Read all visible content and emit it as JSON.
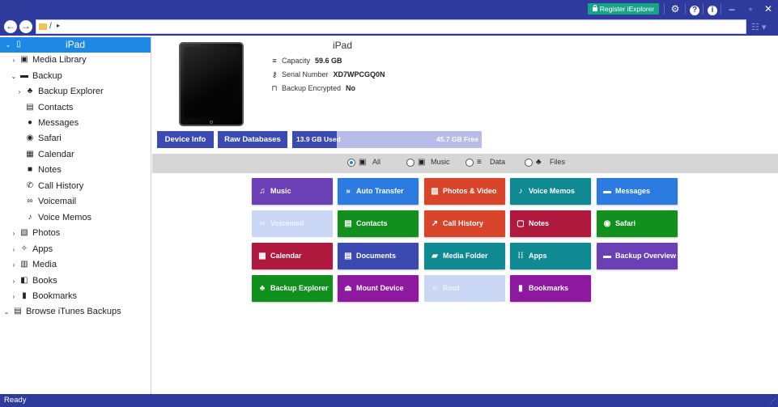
{
  "titlebar": {
    "register_label": "Register iExplorer",
    "icons": [
      "gear-icon",
      "help-icon",
      "info-icon",
      "minimize-icon",
      "maximize-icon",
      "close-icon"
    ]
  },
  "address": {
    "path": "/",
    "caret": "▸"
  },
  "sidebar": {
    "root": {
      "label": "iPad",
      "icon": "tablet-icon"
    },
    "items": [
      {
        "label": "Media Library",
        "icon": "media-library-icon",
        "expander": "›"
      },
      {
        "label": "Backup",
        "icon": "backup-icon",
        "expander": "⌄"
      },
      {
        "label": "Backup Explorer",
        "icon": "sitemap-icon",
        "expander": "›"
      },
      {
        "label": "Contacts",
        "icon": "contact-card-icon"
      },
      {
        "label": "Messages",
        "icon": "chat-icon"
      },
      {
        "label": "Safari",
        "icon": "compass-icon"
      },
      {
        "label": "Calendar",
        "icon": "calendar-icon"
      },
      {
        "label": "Notes",
        "icon": "note-icon"
      },
      {
        "label": "Call History",
        "icon": "phone-icon"
      },
      {
        "label": "Voicemail",
        "icon": "voicemail-icon"
      },
      {
        "label": "Voice Memos",
        "icon": "voice-memo-icon"
      },
      {
        "label": "Photos",
        "icon": "photo-icon",
        "expander": "›"
      },
      {
        "label": "Apps",
        "icon": "apps-icon",
        "expander": "›"
      },
      {
        "label": "Media",
        "icon": "film-icon",
        "expander": "›"
      },
      {
        "label": "Books",
        "icon": "book-icon",
        "expander": "›"
      },
      {
        "label": "Bookmarks",
        "icon": "bookmark-icon",
        "expander": "›"
      },
      {
        "label": "Browse iTunes Backups",
        "icon": "archive-icon",
        "expander": "⌄"
      }
    ]
  },
  "device": {
    "name": "iPad",
    "capacity_label": "Capacity",
    "capacity_value": "59.6 GB",
    "serial_label": "Serial Number",
    "serial_value": "XD7WPCGQ0N",
    "encrypted_label": "Backup Encrypted",
    "encrypted_value": "No"
  },
  "actions": {
    "device_info": "Device Info",
    "raw_databases": "Raw Databases"
  },
  "storage": {
    "used_label": "13.9 GB Used",
    "free_label": "45.7 GB Free",
    "used_fraction": 0.233,
    "used_color": "#3a4ab0",
    "free_color": "#b7bde8"
  },
  "filters": [
    {
      "label": "All",
      "icon": "all-icon",
      "selected": true
    },
    {
      "label": "Music",
      "icon": "music-library-icon",
      "selected": false
    },
    {
      "label": "Data",
      "icon": "database-icon",
      "selected": false
    },
    {
      "label": "Files",
      "icon": "sitemap-icon",
      "selected": false
    }
  ],
  "tiles": [
    {
      "label": "Music",
      "icon": "music-icon",
      "color": "#6b3fb5",
      "enabled": true
    },
    {
      "label": "Auto Transfer",
      "icon": "transfer-icon",
      "color": "#2b7be0",
      "enabled": true
    },
    {
      "label": "Photos & Video",
      "icon": "photo-icon",
      "color": "#d8452a",
      "enabled": true
    },
    {
      "label": "Voice Memos",
      "icon": "voice-memo-icon",
      "color": "#0f8a93",
      "enabled": true
    },
    {
      "label": "Messages",
      "icon": "chat-icon",
      "color": "#2b7be0",
      "enabled": true
    },
    {
      "label": "Voicemail",
      "icon": "voicemail-icon",
      "color": "#c9d7f4",
      "enabled": false
    },
    {
      "label": "Contacts",
      "icon": "contact-card-icon",
      "color": "#12901e",
      "enabled": true
    },
    {
      "label": "Call History",
      "icon": "arrow-icon",
      "color": "#d8452a",
      "enabled": true
    },
    {
      "label": "Notes",
      "icon": "note-icon",
      "color": "#b0193e",
      "enabled": true
    },
    {
      "label": "Safari",
      "icon": "compass-icon",
      "color": "#12901e",
      "enabled": true
    },
    {
      "label": "Calendar",
      "icon": "calendar-icon",
      "color": "#b0193e",
      "enabled": true
    },
    {
      "label": "Documents",
      "icon": "document-icon",
      "color": "#3a4ab0",
      "enabled": true
    },
    {
      "label": "Media Folder",
      "icon": "folder-icon",
      "color": "#0f8a93",
      "enabled": true
    },
    {
      "label": "Apps",
      "icon": "apps-icon",
      "color": "#0f8a93",
      "enabled": true
    },
    {
      "label": "Backup Overview",
      "icon": "backup-icon",
      "color": "#6b3fb5",
      "enabled": true
    },
    {
      "label": "Backup Explorer",
      "icon": "sitemap-icon",
      "color": "#12901e",
      "enabled": true
    },
    {
      "label": "Mount Device",
      "icon": "drive-icon",
      "color": "#8e18a0",
      "enabled": true
    },
    {
      "label": "Root",
      "icon": "database-icon",
      "color": "#c9d7f4",
      "enabled": false
    },
    {
      "label": "Bookmarks",
      "icon": "bookmark-icon",
      "color": "#8e18a0",
      "enabled": true
    }
  ],
  "status": {
    "text": "Ready"
  }
}
